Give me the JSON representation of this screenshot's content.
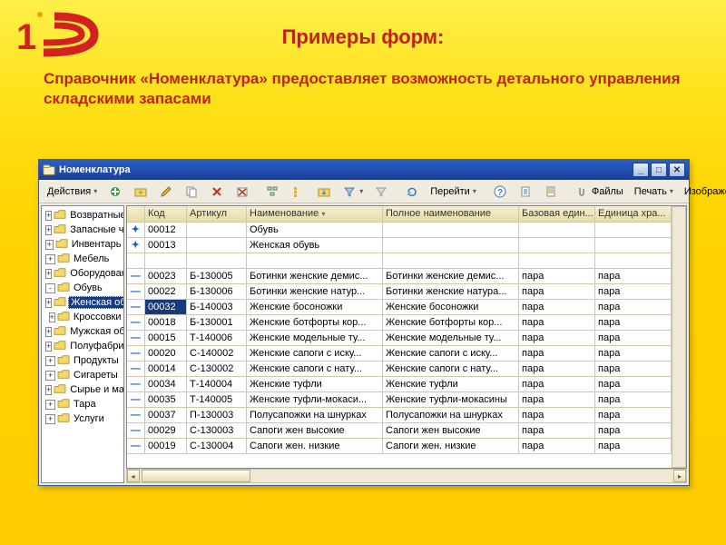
{
  "slide": {
    "title": "Примеры форм:",
    "desc": "Справочник «Номенклатура» предоставляет возможность детального управления складскими запасами"
  },
  "window": {
    "title": "Номенклатура",
    "toolbar": {
      "actions": "Действия",
      "goto": "Перейти",
      "files": "Файлы",
      "print": "Печать",
      "image": "Изображение"
    },
    "tree": {
      "items": [
        {
          "label": "Возвратные отх",
          "level": 1,
          "exp": "+",
          "sel": false
        },
        {
          "label": "Запасные части",
          "level": 1,
          "exp": "+",
          "sel": false
        },
        {
          "label": "Инвентарь",
          "level": 1,
          "exp": "+",
          "sel": false
        },
        {
          "label": "Мебель",
          "level": 1,
          "exp": "+",
          "sel": false
        },
        {
          "label": "Оборудование",
          "level": 1,
          "exp": "+",
          "sel": false
        },
        {
          "label": "Обувь",
          "level": 1,
          "exp": "-",
          "sel": false
        },
        {
          "label": "Женская об",
          "level": 2,
          "exp": "+",
          "sel": true
        },
        {
          "label": "Кроссовки",
          "level": 2,
          "exp": "+",
          "sel": false
        },
        {
          "label": "Мужская об",
          "level": 2,
          "exp": "+",
          "sel": false
        },
        {
          "label": "Полуфабрикаты",
          "level": 1,
          "exp": "+",
          "sel": false
        },
        {
          "label": "Продукты",
          "level": 1,
          "exp": "+",
          "sel": false
        },
        {
          "label": "Сигареты",
          "level": 1,
          "exp": "+",
          "sel": false
        },
        {
          "label": "Сырье и матери",
          "level": 1,
          "exp": "+",
          "sel": false
        },
        {
          "label": "Тара",
          "level": 1,
          "exp": "+",
          "sel": false
        },
        {
          "label": "Услуги",
          "level": 1,
          "exp": "+",
          "sel": false
        }
      ]
    },
    "grid": {
      "columns": [
        "",
        "Код",
        "Артикул",
        "Наименование",
        "Полное наименование",
        "Базовая един...",
        "Единица хра..."
      ],
      "selected_row": 5,
      "selected_col": 1,
      "rows": [
        {
          "m": "f",
          "code": "00012",
          "art": "",
          "name": "Обувь",
          "full": "",
          "base": "",
          "unit": ""
        },
        {
          "m": "f",
          "code": "00013",
          "art": "",
          "name": "Женская обувь",
          "full": "",
          "base": "",
          "unit": ""
        },
        {
          "m": "",
          "code": "",
          "art": "",
          "name": "",
          "full": "",
          "base": "",
          "unit": ""
        },
        {
          "m": "i",
          "code": "00023",
          "art": "Б-130005",
          "name": "Ботинки женские демис...",
          "full": "Ботинки женские демис...",
          "base": "пара",
          "unit": "пара"
        },
        {
          "m": "i",
          "code": "00022",
          "art": "Б-130006",
          "name": "Ботинки женские натур...",
          "full": "Ботинки женские натура...",
          "base": "пара",
          "unit": "пара"
        },
        {
          "m": "i",
          "code": "00032",
          "art": "Б-140003",
          "name": "Женские босоножки",
          "full": "Женские босоножки",
          "base": "пара",
          "unit": "пара"
        },
        {
          "m": "i",
          "code": "00018",
          "art": "Б-130001",
          "name": "Женские ботфорты кор...",
          "full": "Женские ботфорты кор...",
          "base": "пара",
          "unit": "пара"
        },
        {
          "m": "i",
          "code": "00015",
          "art": "Т-140006",
          "name": "Женские модельные ту...",
          "full": "Женские модельные ту...",
          "base": "пара",
          "unit": "пара"
        },
        {
          "m": "i",
          "code": "00020",
          "art": "С-140002",
          "name": "Женские сапоги с иску...",
          "full": "Женские сапоги с иску...",
          "base": "пара",
          "unit": "пара"
        },
        {
          "m": "i",
          "code": "00014",
          "art": "С-130002",
          "name": "Женские сапоги с нату...",
          "full": "Женские сапоги с нату...",
          "base": "пара",
          "unit": "пара"
        },
        {
          "m": "i",
          "code": "00034",
          "art": "Т-140004",
          "name": "Женские туфли",
          "full": "Женские туфли",
          "base": "пара",
          "unit": "пара"
        },
        {
          "m": "i",
          "code": "00035",
          "art": "Т-140005",
          "name": "Женские туфли-мокаси...",
          "full": "Женские туфли-мокасины",
          "base": "пара",
          "unit": "пара"
        },
        {
          "m": "i",
          "code": "00037",
          "art": "П-130003",
          "name": "Полусапожки на шнурках",
          "full": "Полусапожки на шнурках",
          "base": "пара",
          "unit": "пара"
        },
        {
          "m": "i",
          "code": "00029",
          "art": "С-130003",
          "name": "Сапоги жен высокие",
          "full": "Сапоги жен высокие",
          "base": "пара",
          "unit": "пара"
        },
        {
          "m": "i",
          "code": "00019",
          "art": "С-130004",
          "name": "Сапоги жен. низкие",
          "full": "Сапоги жен. низкие",
          "base": "пара",
          "unit": "пара"
        }
      ]
    }
  }
}
